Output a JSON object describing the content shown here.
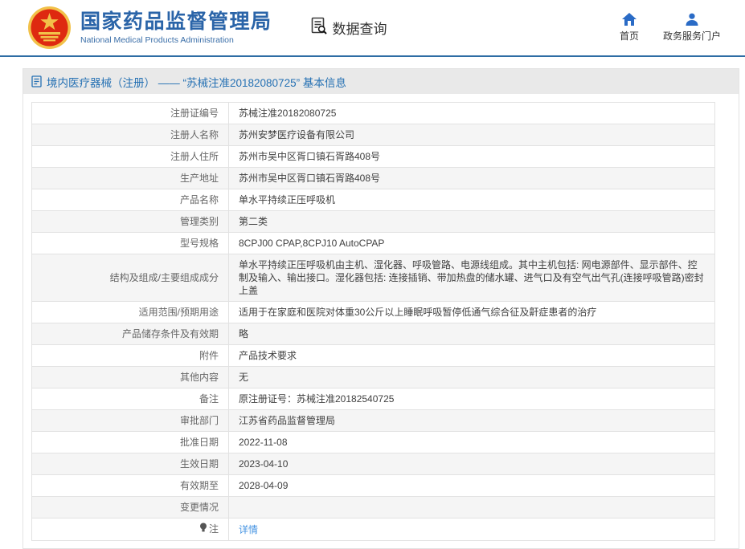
{
  "header": {
    "org_title": "国家药品监督管理局",
    "org_subtitle": "National Medical Products Administration",
    "section_label": "数据查询",
    "nav": [
      {
        "label": "首页"
      },
      {
        "label": "政务服务门户"
      }
    ]
  },
  "breadcrumb": {
    "text": "境内医疗器械（注册） —— “苏械注准20182080725” 基本信息"
  },
  "table": {
    "rows": [
      {
        "label": "注册证编号",
        "value": "苏械注准20182080725"
      },
      {
        "label": "注册人名称",
        "value": "苏州安梦医疗设备有限公司"
      },
      {
        "label": "注册人住所",
        "value": "苏州市吴中区胥口镇石胥路408号"
      },
      {
        "label": "生产地址",
        "value": "苏州市吴中区胥口镇石胥路408号"
      },
      {
        "label": "产品名称",
        "value": "单水平持续正压呼吸机"
      },
      {
        "label": "管理类别",
        "value": "第二类"
      },
      {
        "label": "型号规格",
        "value": "8CPJ00 CPAP,8CPJ10 AutoCPAP"
      },
      {
        "label": "结构及组成/主要组成成分",
        "value": "单水平持续正压呼吸机由主机、湿化器、呼吸管路、电源线组成。其中主机包括: 网电源部件、显示部件、控制及输入、输出接口。湿化器包括: 连接插销、带加热盘的储水罐、进气口及有空气出气孔(连接呼吸管路)密封上盖"
      },
      {
        "label": "适用范围/预期用途",
        "value": "适用于在家庭和医院对体重30公斤以上睡眠呼吸暂停低通气综合征及鼾症患者的治疗"
      },
      {
        "label": "产品储存条件及有效期",
        "value": "略"
      },
      {
        "label": "附件",
        "value": "产品技术要求"
      },
      {
        "label": "其他内容",
        "value": "无"
      },
      {
        "label": "备注",
        "value": "原注册证号：苏械注准20182540725"
      },
      {
        "label": "审批部门",
        "value": "江苏省药品监督管理局"
      },
      {
        "label": "批准日期",
        "value": "2022-11-08"
      },
      {
        "label": "生效日期",
        "value": "2023-04-10"
      },
      {
        "label": "有效期至",
        "value": "2028-04-09"
      },
      {
        "label": "变更情况",
        "value": ""
      },
      {
        "label": "注",
        "value": "详情",
        "icon": "bulb",
        "link": true
      }
    ]
  },
  "colors": {
    "brand_blue": "#2a64a8",
    "header_rule": "#2e6da4",
    "nav_icon_blue": "#2a6bc6",
    "breadcrumb_bg": "#e9e9e9",
    "breadcrumb_text": "#2470b3",
    "row_alt_bg": "#f5f5f5",
    "table_border": "#e2e2e2",
    "link_blue": "#4493e2",
    "emblem_red": "#de2910",
    "emblem_gold": "#f2c149"
  }
}
